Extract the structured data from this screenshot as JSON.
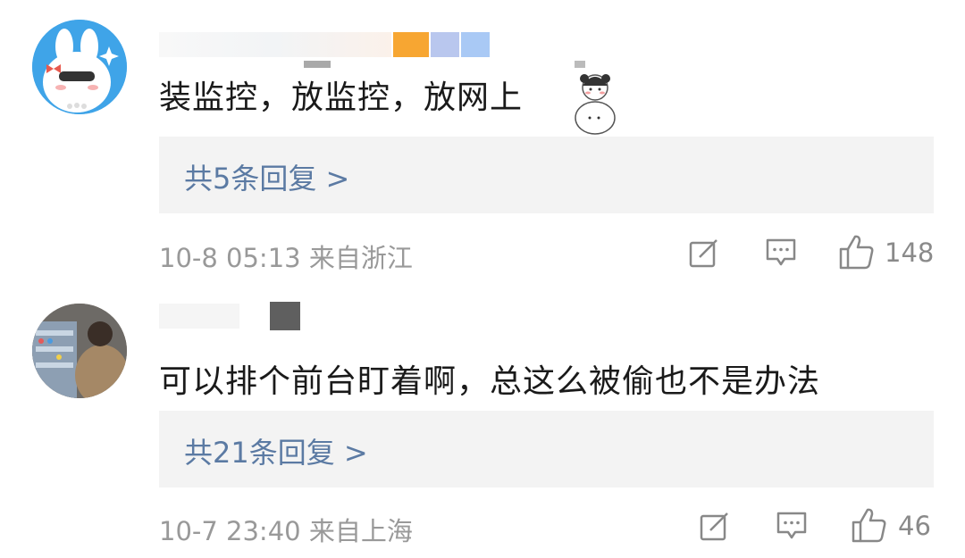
{
  "comments": [
    {
      "text": "装监控，放监控，放网上",
      "reply_label": "共5条回复 >",
      "meta": "10-8 05:13 来自浙江",
      "likes": "148",
      "icons": [
        "edit-icon",
        "comment-icon",
        "thumbs-up-icon"
      ]
    },
    {
      "text": "可以排个前台盯着啊，总这么被偷也不是办法",
      "reply_label": "共21条回复 >",
      "meta": "10-7 23:40 来自上海",
      "likes": "46",
      "icons": [
        "edit-icon",
        "comment-icon",
        "thumbs-up-icon"
      ]
    }
  ],
  "colors": {
    "reply_link": "#5b7aa3",
    "reply_bg": "#f3f3f3",
    "meta": "#999999",
    "text": "#1a1a1a"
  }
}
